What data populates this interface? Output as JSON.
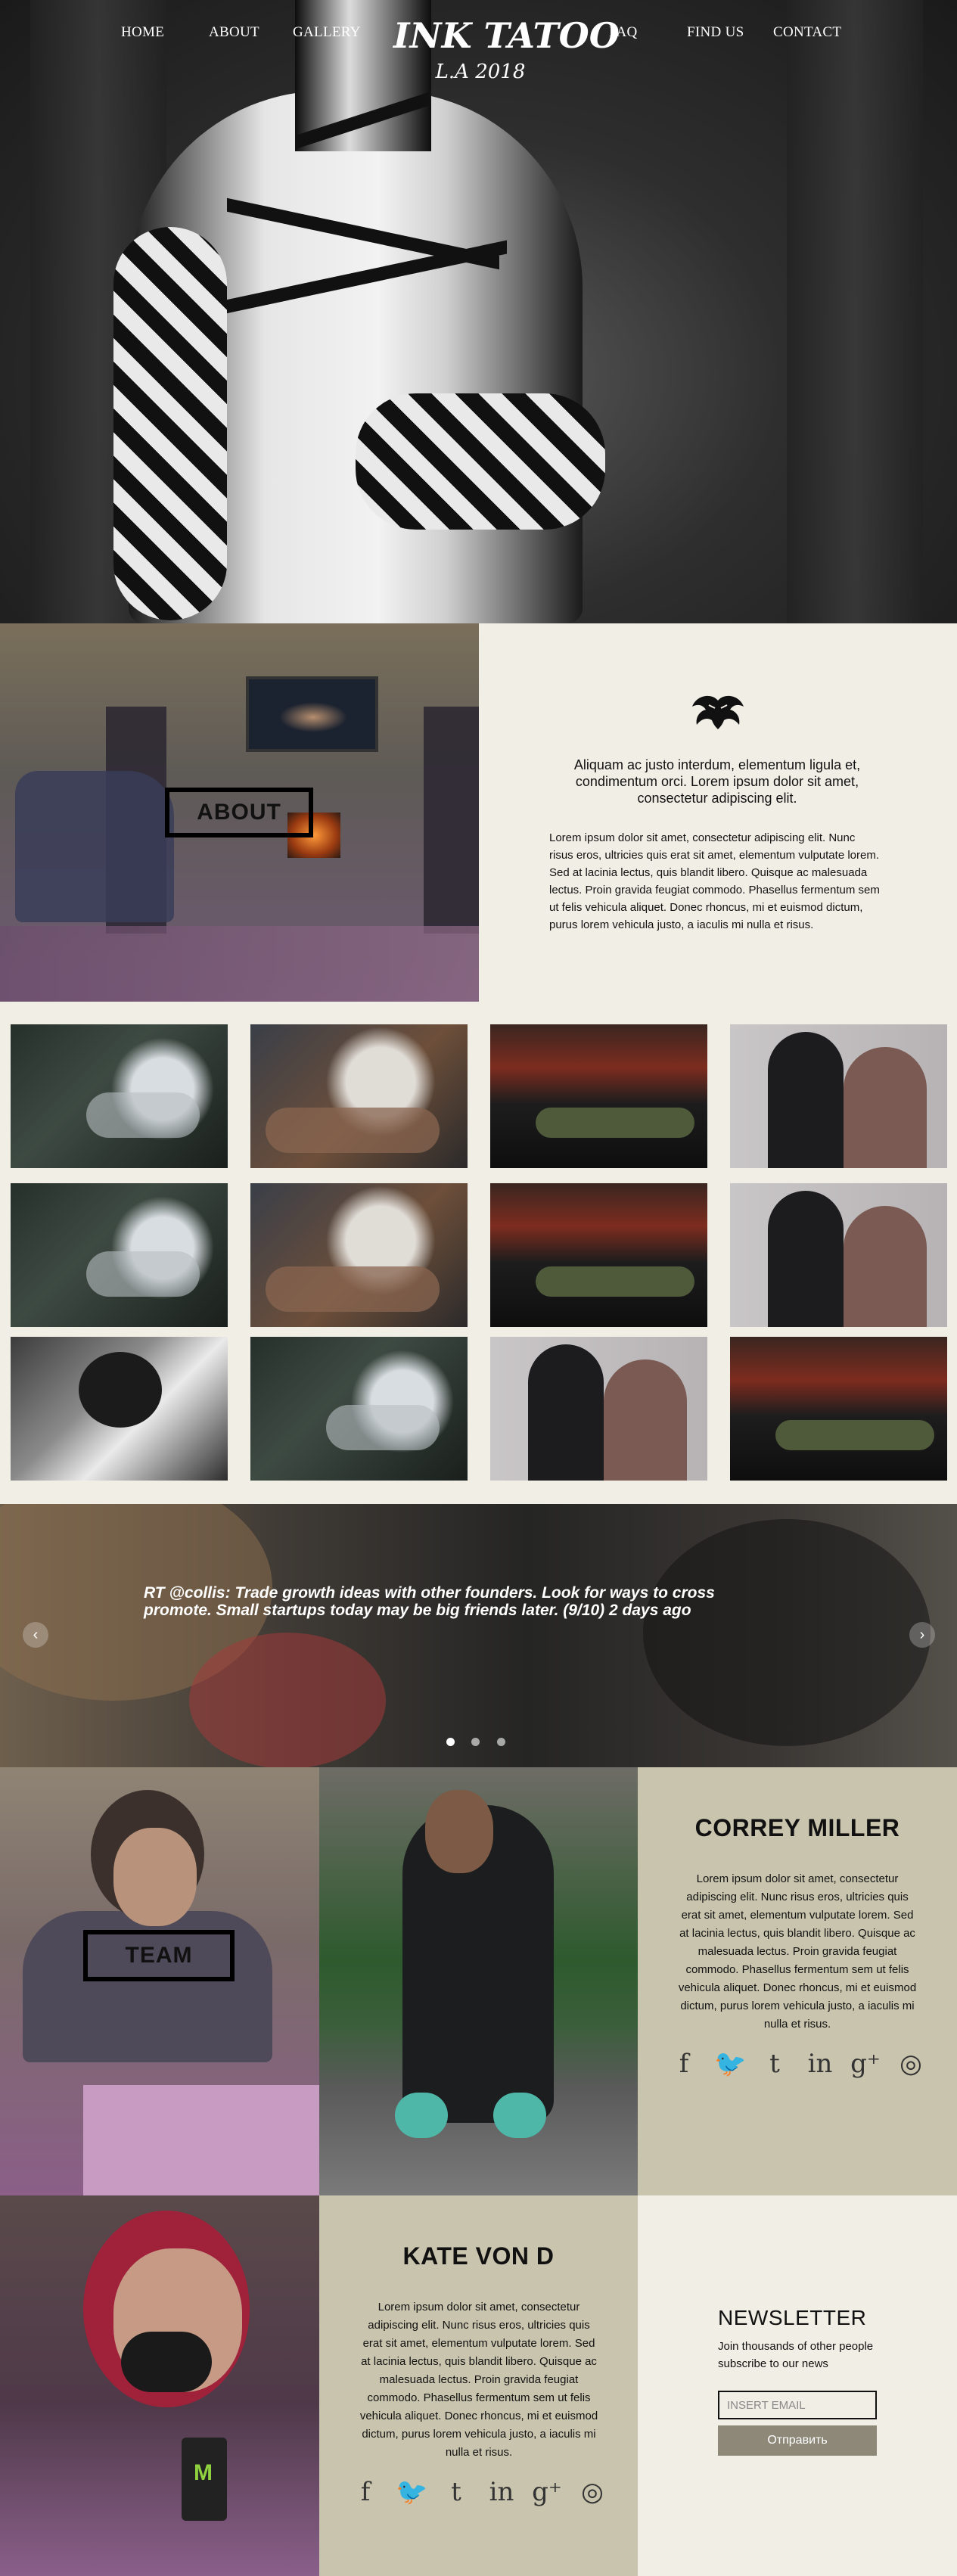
{
  "nav": {
    "home": "HOME",
    "about": "ABOUT",
    "gallery": "GALLERY",
    "faq": "FAQ",
    "find_us": "FIND US",
    "contact": "CONTACT"
  },
  "brand": {
    "logo": "INK TATOO",
    "subtitle": "L.A 2018"
  },
  "about": {
    "heading": "ABOUT",
    "lead": "Aliquam ac justo interdum, elementum ligula et, condimentum orci. Lorem ipsum dolor sit amet, consectetur adipiscing elit.",
    "body": "Lorem ipsum dolor sit amet, consectetur adipiscing elit. Nunc risus eros, ultricies quis erat sit amet, elementum vulputate lorem. Sed at lacinia lectus, quis blandit libero. Quisque ac malesuada lectus. Proin gravida feugiat commodo. Phasellus fermentum sem ut felis vehicula aliquet. Donec rhoncus, mi et euismod dictum, purus lorem vehicula justo, a iaculis mi nulla et risus."
  },
  "gallery": {
    "items": [
      {
        "subject": "tattooing-gloved-hands"
      },
      {
        "subject": "tattooed-hands-on-sketch"
      },
      {
        "subject": "client-on-tattoo-bed"
      },
      {
        "subject": "tattooed-couple-portrait"
      },
      {
        "subject": "tattooing-gloved-hands"
      },
      {
        "subject": "tattooed-hands-on-sketch"
      },
      {
        "subject": "client-on-tattoo-bed"
      },
      {
        "subject": "tattooed-couple-portrait"
      },
      {
        "subject": "artist-at-work"
      },
      {
        "subject": "tattooing-gloved-hands"
      },
      {
        "subject": "tattooed-couple-portrait"
      },
      {
        "subject": "client-on-tattoo-bed"
      }
    ]
  },
  "quote": {
    "text": "RT @collis: Trade growth ideas with other founders. Look for ways to cross promote. Small startups today may be big friends later. (9/10) 2 days ago",
    "slides": 3,
    "active_slide": 1,
    "prev_icon": "‹",
    "next_icon": "›"
  },
  "team": {
    "heading": "TEAM",
    "members": [
      {
        "name": "CORREY MILLER",
        "bio": "Lorem ipsum dolor sit amet, consectetur adipiscing elit. Nunc risus eros, ultricies quis erat sit amet, elementum vulputate lorem. Sed at lacinia lectus, quis blandit libero. Quisque ac malesuada lectus. Proin gravida feugiat commodo. Phasellus fermentum sem ut felis vehicula aliquet. Donec rhoncus, mi et euismod dictum, purus lorem vehicula justo, a iaculis mi nulla et risus."
      },
      {
        "name": "KATE VON D",
        "bio": "Lorem ipsum dolor sit amet, consectetur adipiscing elit. Nunc risus eros, ultricies quis erat sit amet, elementum vulputate lorem. Sed at lacinia lectus, quis blandit libero. Quisque ac malesuada lectus. Proin gravida feugiat commodo. Phasellus fermentum sem ut felis vehicula aliquet. Donec rhoncus, mi et euismod dictum, purus lorem vehicula justo, a iaculis mi nulla et risus."
      }
    ],
    "social_icons": [
      "facebook-icon",
      "twitter-icon",
      "tumblr-icon",
      "linkedin-icon",
      "google-plus-icon",
      "instagram-icon"
    ],
    "social_glyphs": [
      "f",
      "🐦",
      "t",
      "in",
      "g⁺",
      "◎"
    ]
  },
  "newsletter": {
    "title": "NEWSLETTER",
    "description": "Join thousands of other people subscribe to our news",
    "placeholder": "INSERT EMAIL",
    "button": "Отправить"
  },
  "colors": {
    "cream": "#f1eee6",
    "khaki": "#c9c4ad",
    "button": "#8d8878",
    "dark": "#111111"
  }
}
